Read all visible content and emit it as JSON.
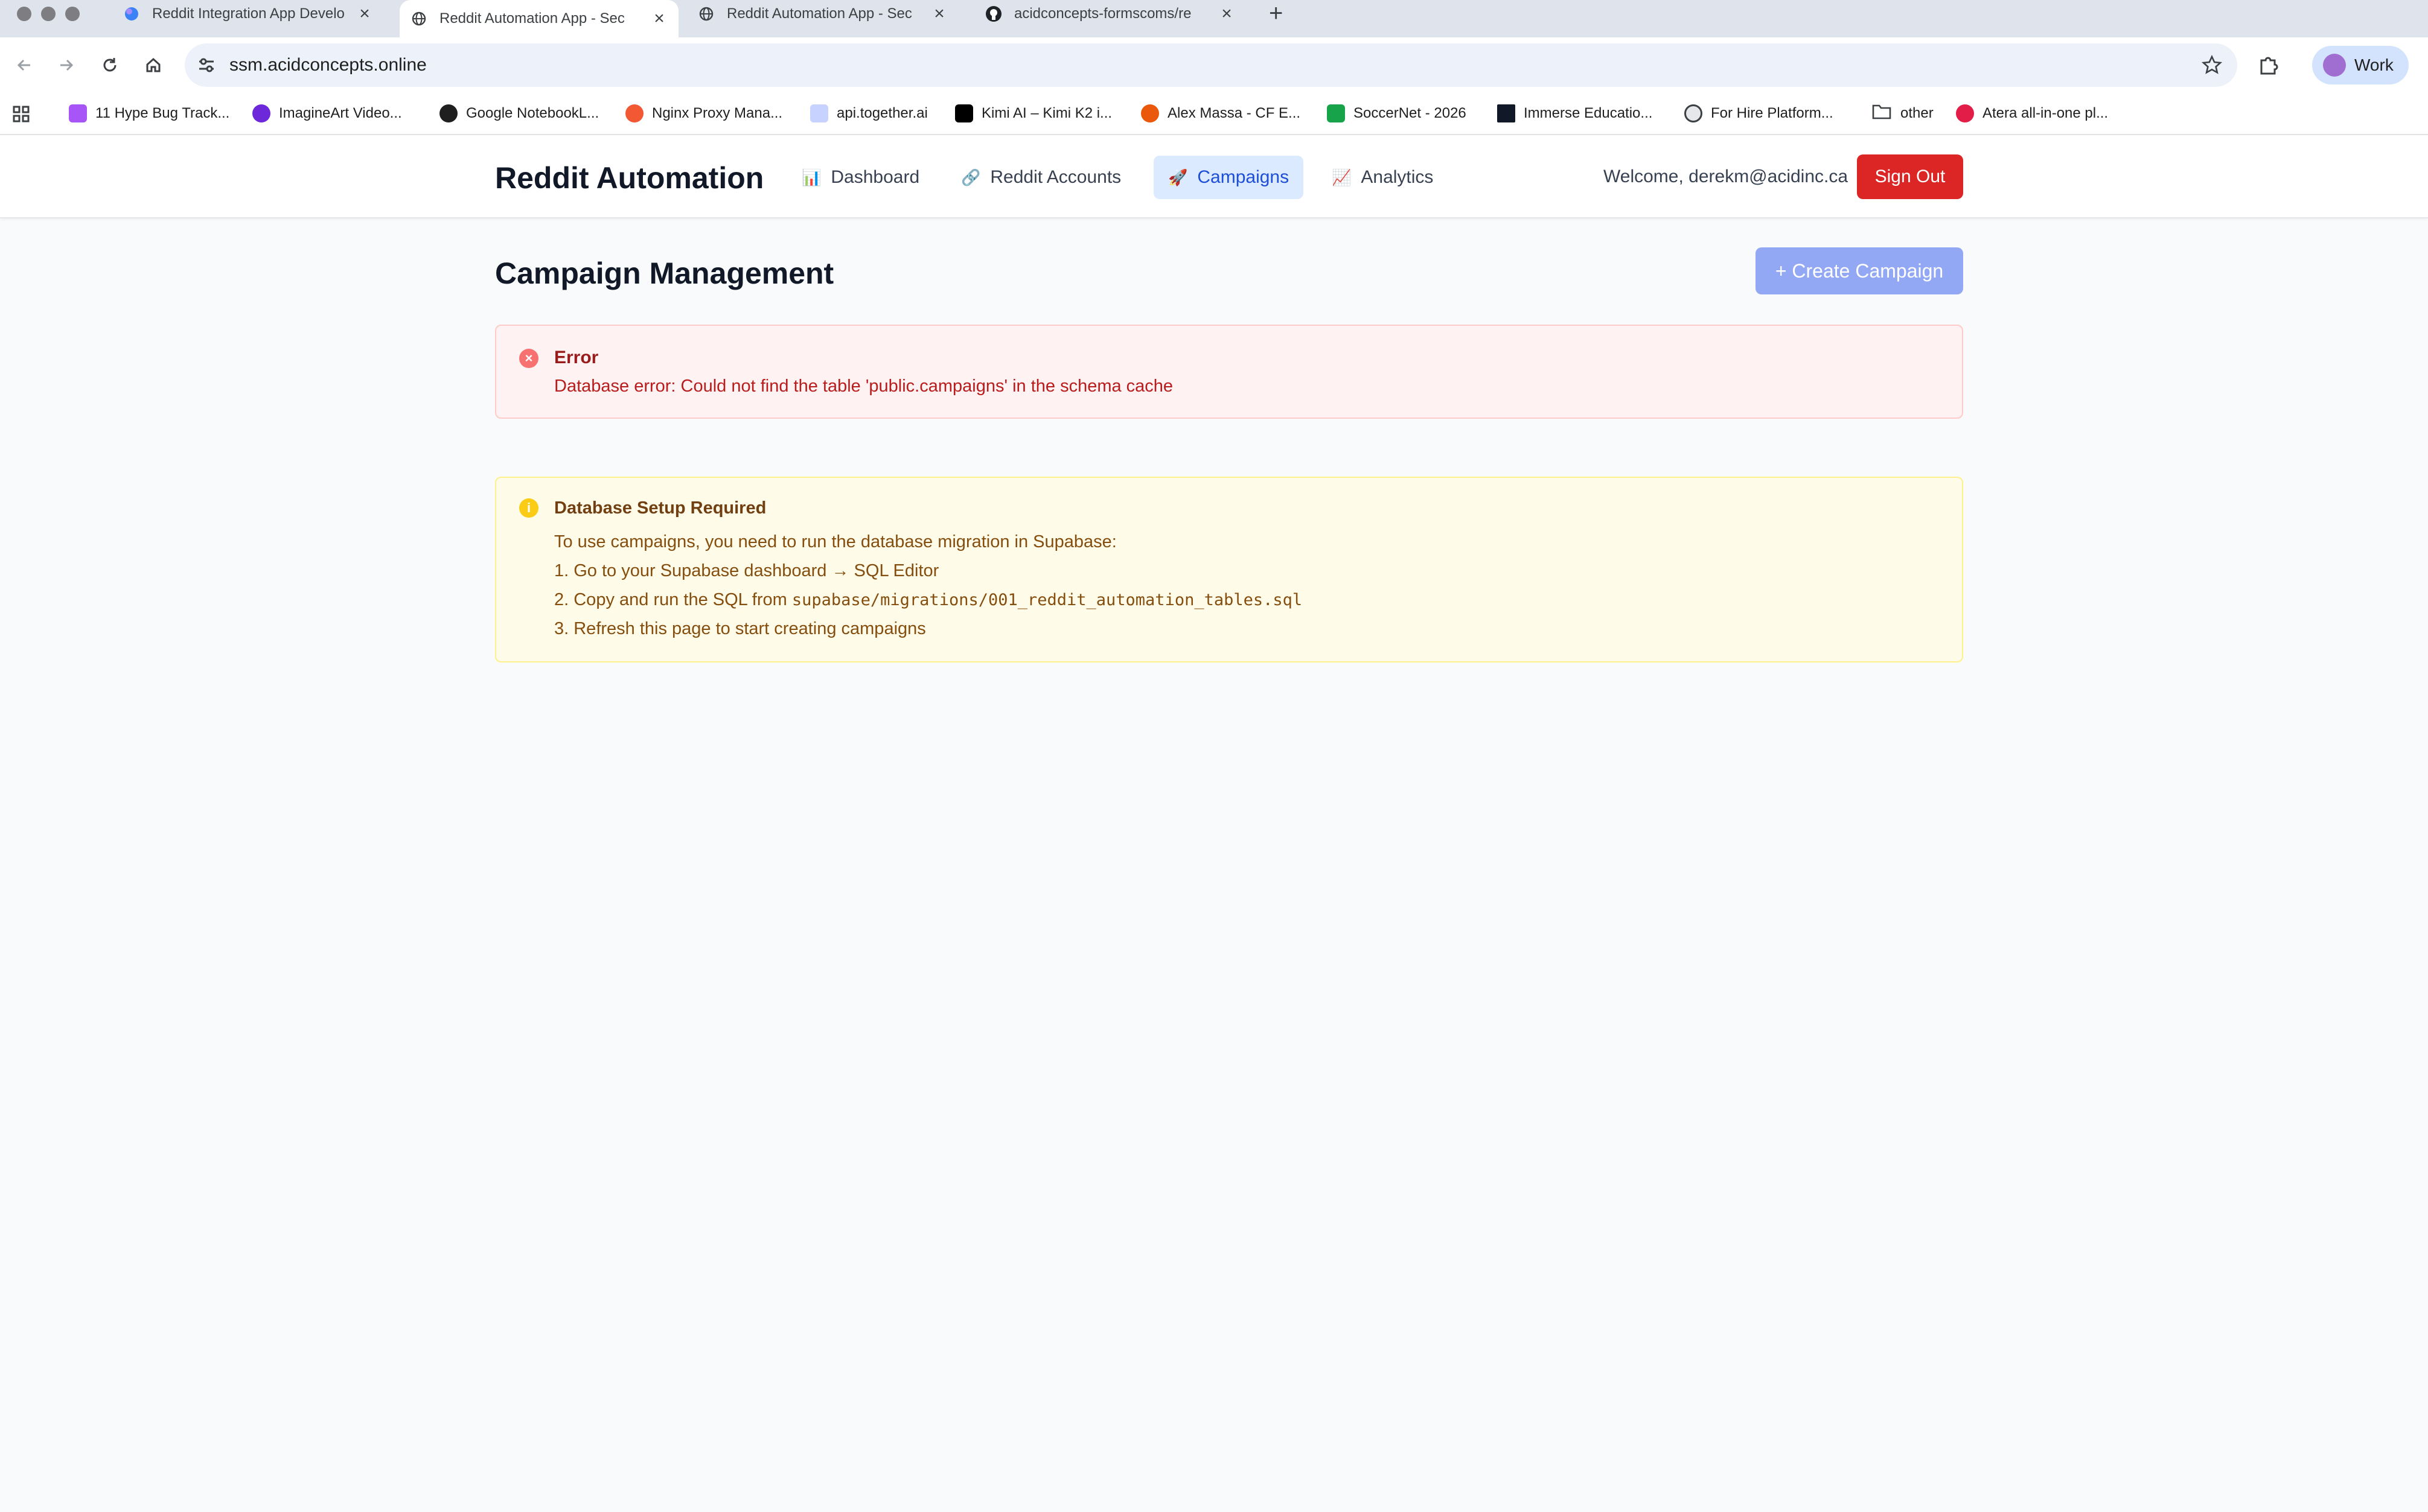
{
  "browser": {
    "tabs": [
      {
        "title": "Reddit Integration App Develo",
        "active": false
      },
      {
        "title": "Reddit Automation App - Sec",
        "active": true
      },
      {
        "title": "Reddit Automation App - Sec",
        "active": false
      },
      {
        "title": "acidconcepts-formscoms/re",
        "active": false
      }
    ],
    "url": "ssm.acidconcepts.online",
    "profile_label": "Work",
    "bookmarks": [
      "11 Hype Bug Track...",
      "ImagineArt Video...",
      "Google NotebookL...",
      "Nginx Proxy Mana...",
      "api.together.ai",
      "Kimi AI – Kimi K2 i...",
      "Alex Massa - CF E...",
      "SoccerNet - 2026",
      "Immerse Educatio...",
      "For Hire Platform...",
      "other",
      "Atera all-in-one pl..."
    ]
  },
  "app": {
    "brand": "Reddit Automation",
    "nav": [
      {
        "label": "Dashboard",
        "icon": "📊"
      },
      {
        "label": "Reddit Accounts",
        "icon": "🔗"
      },
      {
        "label": "Campaigns",
        "icon": "🚀"
      },
      {
        "label": "Analytics",
        "icon": "📈"
      }
    ],
    "welcome": "Welcome, derekm@acidinc.ca",
    "signout_label": "Sign Out"
  },
  "main": {
    "title": "Campaign Management",
    "create_label": "+ Create Campaign",
    "error": {
      "title": "Error",
      "message": "Database error: Could not find the table 'public.campaigns' in the schema cache"
    },
    "setup": {
      "title": "Database Setup Required",
      "intro": "To use campaigns, you need to run the database migration in Supabase:",
      "step1": "1. Go to your Supabase dashboard → SQL Editor",
      "step2_prefix": "2. Copy and run the SQL from ",
      "step2_code": "supabase/migrations/001_reddit_automation_tables.sql",
      "step3": "3. Refresh this page to start creating campaigns"
    }
  },
  "colors": {
    "accent": "#1d4ed8",
    "danger": "#dc2626",
    "create_button": "#93a8f4"
  }
}
